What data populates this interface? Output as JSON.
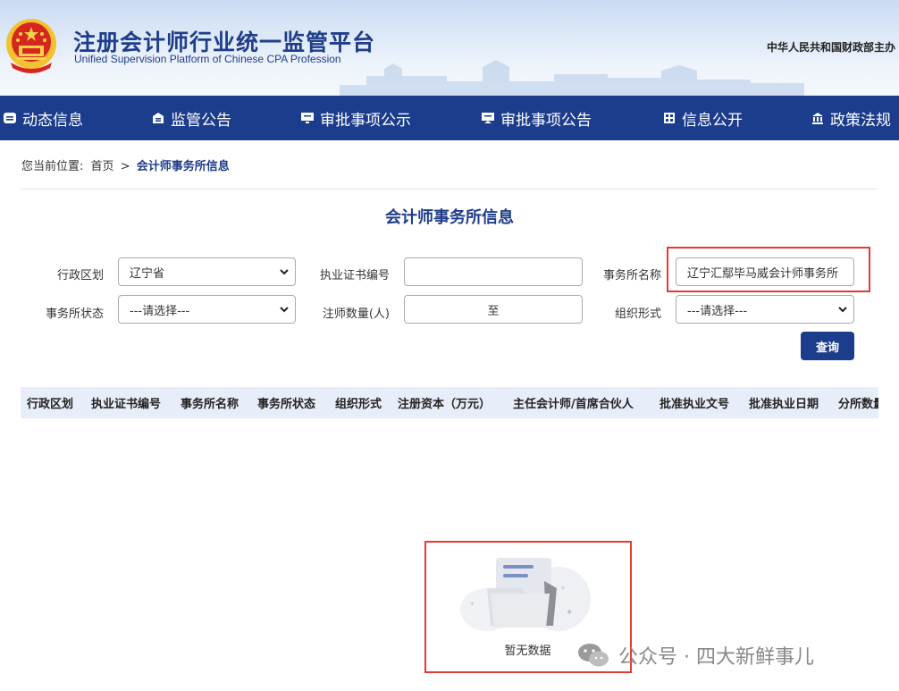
{
  "header": {
    "title": "注册会计师行业统一监管平台",
    "subtitle": "Unified Supervision Platform of Chinese CPA Profession",
    "sponsor": "中华人民共和国财政部主办"
  },
  "nav": {
    "items": [
      {
        "label": "动态信息",
        "icon": "news-icon"
      },
      {
        "label": "监管公告",
        "icon": "notice-icon"
      },
      {
        "label": "审批事项公示",
        "icon": "monitor-icon"
      },
      {
        "label": "审批事项公告",
        "icon": "announce-icon"
      },
      {
        "label": "信息公开",
        "icon": "grid-icon"
      },
      {
        "label": "政策法规",
        "icon": "building-icon"
      }
    ]
  },
  "breadcrumb": {
    "prefix": "您当前位置:",
    "home": "首页",
    "separator": ">",
    "current": "会计师事务所信息"
  },
  "page_title": "会计师事务所信息",
  "form": {
    "region_label": "行政区划",
    "region_value": "辽宁省",
    "license_label": "执业证书编号",
    "license_value": "",
    "firm_name_label": "事务所名称",
    "firm_name_value": "辽宁汇鄢毕马威会计师事务所",
    "status_label": "事务所状态",
    "status_value": "---请选择---",
    "cpa_count_label": "注师数量(人)",
    "cpa_count_separator": "至",
    "org_form_label": "组织形式",
    "org_form_value": "---请选择---",
    "query_button": "查询"
  },
  "table": {
    "columns": [
      "行政区划",
      "执业证书编号",
      "事务所名称",
      "事务所状态",
      "组织形式",
      "注册资本（万元）",
      "主任会计师/首席合伙人",
      "批准执业文号",
      "批准执业日期",
      "分所数量"
    ]
  },
  "empty_state": {
    "text": "暂无数据"
  },
  "watermark": {
    "text": "公众号 · 四大新鲜事儿"
  },
  "colors": {
    "brand": "#1c3d8c",
    "highlight": "#e53935",
    "table_header_bg": "#e8eef9"
  }
}
